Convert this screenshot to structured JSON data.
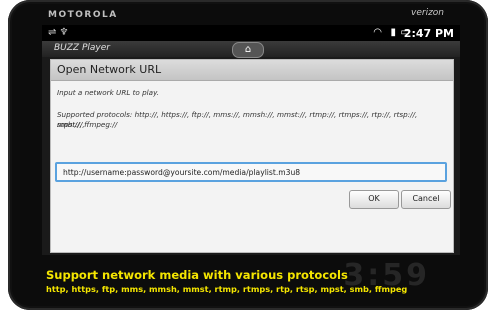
{
  "device": {
    "brand": "MOTOROLA",
    "carrier": "verizon"
  },
  "statusbar": {
    "usb_icon": "usb-icon",
    "time": "2:47 PM"
  },
  "appbar": {
    "app_name": "BUZZ Player",
    "home_icon": "home-icon"
  },
  "dialog": {
    "title": "Open Network URL",
    "instruction": "Input a network URL to play.",
    "protocols_line1": "Supported protocols: http://, https://, ftp://, mms://, mmsh://, mmst://, rtmp://, rtmps://, rtp://, rtsp://, mpst://,",
    "protocols_line2": "smb://, ffmpeg://",
    "url_value": "http://username:password@yoursite.com/media/playlist.m3u8",
    "ok_label": "OK",
    "cancel_label": "Cancel"
  },
  "caption": {
    "headline": "Support network media with various protocols",
    "protocols": "http, https, ftp, mms, mmsh, mmst, rtmp, rtmps, rtp, rtsp, mpst, smb, ffmpeg"
  },
  "background_clock": "3:59"
}
